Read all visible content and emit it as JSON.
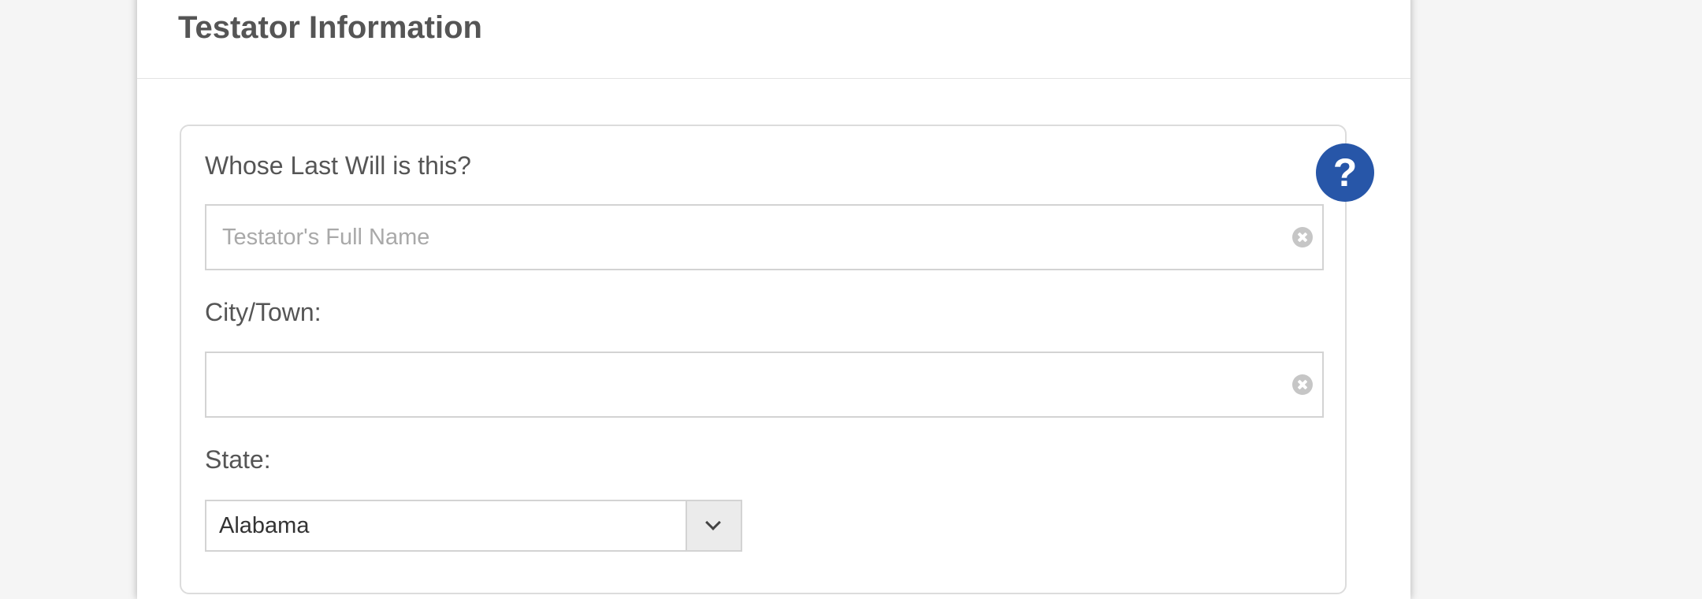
{
  "section": {
    "title": "Testator Information"
  },
  "question": {
    "prompt": "Whose Last Will is this?",
    "help_label": "?"
  },
  "fields": {
    "full_name": {
      "value": "",
      "placeholder": "Testator's Full Name"
    },
    "city": {
      "label": "City/Town:",
      "value": "",
      "placeholder": ""
    },
    "state": {
      "label": "State:",
      "selected": "Alabama"
    }
  },
  "icons": {
    "help": "question-mark-icon",
    "clear": "clear-icon",
    "dropdown": "chevron-down-icon"
  },
  "colors": {
    "accent": "#2756a8",
    "text": "#555555",
    "placeholder": "#a9a9a9",
    "border": "#d3d3d3",
    "background": "#f5f5f5"
  }
}
